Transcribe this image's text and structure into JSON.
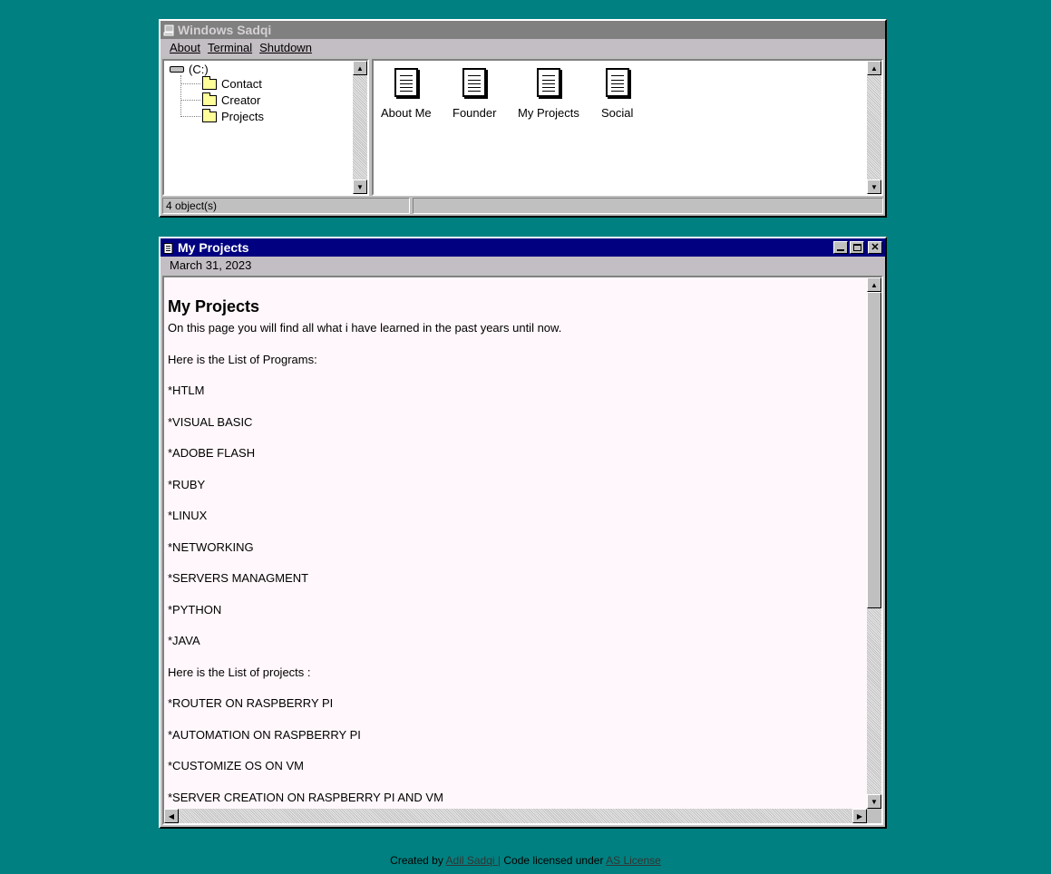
{
  "explorer": {
    "title": "Windows Sadqi",
    "menu": [
      "About",
      "Terminal",
      "Shutdown"
    ],
    "tree_root": "(C:)",
    "tree_items": [
      "Contact",
      "Creator",
      "Projects"
    ],
    "icons": [
      "About Me",
      "Founder",
      "My Projects",
      "Social"
    ],
    "status": "4 object(s)"
  },
  "doc_window": {
    "title": "My Projects",
    "date": "March 31, 2023",
    "heading": "My Projects",
    "paragraphs": [
      "On this page you will find all what i have learned in the past years until now.",
      "Here is the List of Programs:",
      "*HTLM",
      "*VISUAL BASIC",
      "*ADOBE FLASH",
      "*RUBY",
      "*LINUX",
      "*NETWORKING",
      "*SERVERS MANAGMENT",
      "*PYTHON",
      "*JAVA",
      "Here is the List of projects :",
      "*ROUTER ON RASPBERRY PI",
      "*AUTOMATION ON RASPBERRY PI",
      "*CUSTOMIZE OS ON VM",
      "*SERVER CREATION ON RASPBERRY PI AND VM"
    ]
  },
  "footer": {
    "created_by": "Created by",
    "author_link": "Adil Sadqi |",
    "licensed": "Code licensed under",
    "license_link": "AS License"
  }
}
